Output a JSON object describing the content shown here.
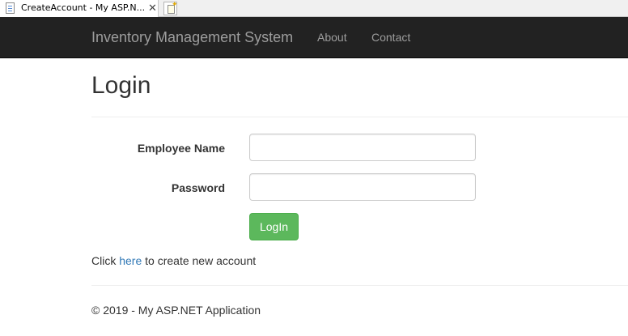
{
  "browser": {
    "tab_title": "CreateAccount - My ASP.N...",
    "close_glyph": "✕"
  },
  "navbar": {
    "brand": "Inventory Management System",
    "links": [
      "About",
      "Contact"
    ]
  },
  "page": {
    "title": "Login"
  },
  "form": {
    "employee_name_label": "Employee Name",
    "employee_name_value": "",
    "password_label": "Password",
    "password_value": "",
    "login_button": "LogIn"
  },
  "create_account": {
    "prefix": "Click ",
    "link": "here",
    "suffix": " to create new account"
  },
  "footer": {
    "text": "© 2019 - My ASP.NET Application"
  },
  "colors": {
    "navbar_bg": "#222222",
    "navbar_text": "#9d9d9d",
    "button_success": "#5cb85c",
    "link": "#337ab7"
  },
  "icons": {
    "tab_icon": "page-icon",
    "new_tab_icon": "new-tab-icon"
  }
}
